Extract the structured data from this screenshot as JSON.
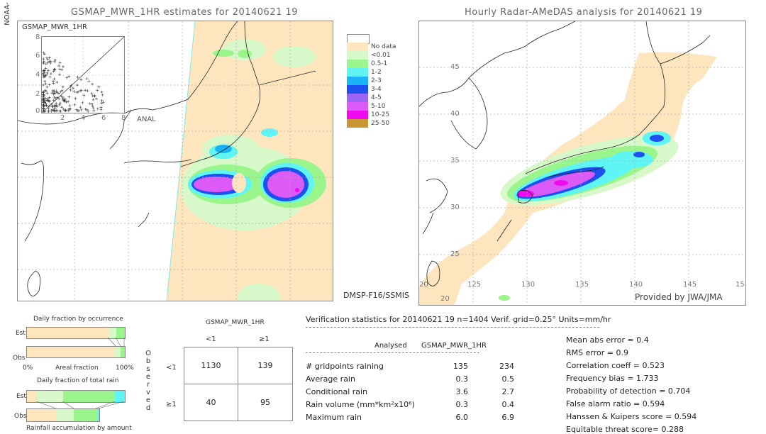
{
  "side_label": "NOAA-",
  "left_map": {
    "title": "GSMAP_MWR_1HR estimates for 20140621 19",
    "inset": {
      "title": "GSMAP_MWR_1HR",
      "y_ticks": [
        "8",
        "6",
        "4",
        "2",
        "0"
      ],
      "x_ticks": [
        "2",
        "4",
        "6",
        "8"
      ],
      "x_label": "ANAL"
    },
    "sensor_label": "DMSP-F16/SSMIS"
  },
  "legend": {
    "items": [
      {
        "label": "",
        "color": "#ffffff"
      },
      {
        "label": "No data",
        "color": "#fde6bd"
      },
      {
        "label": "<0.01",
        "color": "#d7f8c8"
      },
      {
        "label": "0.5-1",
        "color": "#99f58c"
      },
      {
        "label": "1-2",
        "color": "#5ff5f5"
      },
      {
        "label": "2-3",
        "color": "#19b4f5"
      },
      {
        "label": "3-4",
        "color": "#1e50f0"
      },
      {
        "label": "4-5",
        "color": "#9a64f5"
      },
      {
        "label": "5-10",
        "color": "#dc5af5"
      },
      {
        "label": "10-25",
        "color": "#f00af0"
      },
      {
        "label": "25-50",
        "color": "#c89632"
      }
    ]
  },
  "right_map": {
    "title": "Hourly Radar-AMeDAS analysis for 20140621 19",
    "lat_ticks": [
      "45",
      "40",
      "35",
      "30",
      "25",
      "20"
    ],
    "lon_ticks": [
      "20",
      "125",
      "130",
      "135",
      "140",
      "145",
      "15"
    ],
    "bottom_lat": "20",
    "credit": "Provided by JWA/JMA"
  },
  "occurrence": {
    "title": "Daily fraction by occurrence",
    "est_label": "Est",
    "obs_label": "Obs",
    "axis_left": "0%",
    "axis_mid": "Areal fraction",
    "axis_right": "100%",
    "est_fractions": [
      0.83,
      0.08,
      0.08,
      0.01
    ],
    "obs_fractions": [
      0.9,
      0.06,
      0.035,
      0.005
    ]
  },
  "total_rain": {
    "title": "Daily fraction of total rain",
    "est_label": "Est",
    "obs_label": "Obs",
    "footer": "Rainfall accumulation by amount",
    "est_fractions": [
      0.1,
      0.27,
      0.53,
      0.1
    ],
    "obs_fractions": [
      0.41,
      0.24,
      0.32,
      0.03
    ]
  },
  "contingency": {
    "header": "GSMAP_MWR_1HR",
    "col_labels": [
      "<1",
      "≥1"
    ],
    "row_labels": [
      "<1",
      "≥1"
    ],
    "side_label_letters": [
      "O",
      "b",
      "s",
      "e",
      "r",
      "v",
      "e",
      "d"
    ],
    "cells": [
      [
        "1130",
        "139"
      ],
      [
        "40",
        "95"
      ]
    ]
  },
  "verification": {
    "header": "Verification statistics for 20140621 19   n=1404   Verif. grid=0.25°   Units=mm/hr",
    "col_analysed": "Analysed",
    "col_gsmap": "GSMAP_MWR_1HR",
    "rows": [
      {
        "label": "# gridpoints raining",
        "analysed": "135",
        "gsmap": "234"
      },
      {
        "label": "Average rain",
        "analysed": "0.3",
        "gsmap": "0.5"
      },
      {
        "label": "Conditional rain",
        "analysed": "3.6",
        "gsmap": "2.7"
      },
      {
        "label": "Rain volume (mm*km²x10⁶)",
        "analysed": "0.3",
        "gsmap": "0.4"
      },
      {
        "label": "Maximum rain",
        "analysed": "6.0",
        "gsmap": "6.9"
      }
    ],
    "scores": [
      "Mean abs error = 0.4",
      "RMS error = 0.9",
      "Correlation coeff = 0.523",
      "Frequency bias = 1.733",
      "Probability of detection = 0.704",
      "False alarm ratio = 0.594",
      "Hanssen & Kuipers score = 0.594",
      "Equitable threat score= 0.288"
    ]
  }
}
